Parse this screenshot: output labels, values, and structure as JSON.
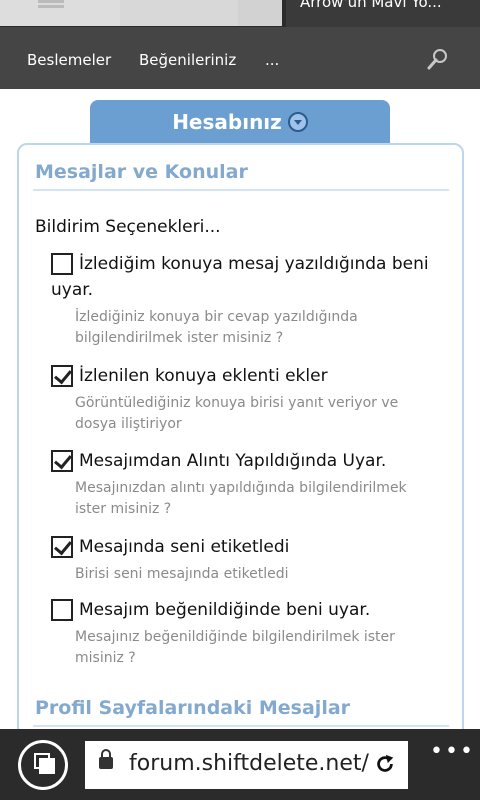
{
  "browser": {
    "active_tab_title": "Arrow'un Mavi Yo...",
    "url": "forum.shiftdelete.net/"
  },
  "nav": {
    "items": [
      "Beslemeler",
      "Beğenileriniz",
      "..."
    ]
  },
  "account_tab": {
    "label": "Hesabınız"
  },
  "sections": [
    {
      "title": "Mesajlar ve Konular"
    },
    {
      "title": "Profil Sayfalarındaki Mesajlar"
    }
  ],
  "notifications": {
    "heading": "Bildirim Seçenekleri...",
    "options": [
      {
        "label": "İzlediğim konuya mesaj yazıldığında beni uyar.",
        "hint": "İzlediğiniz konuya bir cevap yazıldığında bilgilendirilmek ister misiniz ?",
        "checked": false
      },
      {
        "label": "İzlenilen konuya eklenti ekler",
        "hint": "Görüntülediğiniz konuya birisi yanıt veriyor ve dosya iliştiriyor",
        "checked": true
      },
      {
        "label": "Mesajımdan Alıntı Yapıldığında Uyar.",
        "hint": "Mesajınızdan alıntı yapıldığında bilgilendirilmek ister misiniz ?",
        "checked": true
      },
      {
        "label": "Mesajında seni etiketledi",
        "hint": "Birisi seni mesajında etiketledi",
        "checked": true
      },
      {
        "label": "Mesajım beğenildiğinde beni uyar.",
        "hint": "Mesajınız beğenildiğinde bilgilendirilmek ister misiniz ?",
        "checked": false
      }
    ]
  },
  "icons": {
    "menu": "hamburger-menu-icon",
    "search": "search-icon",
    "dropdown": "chevron-down-circle-icon",
    "tabs": "tabs-icon",
    "lock": "lock-icon",
    "reload": "reload-icon",
    "more": "more-icon"
  },
  "colors": {
    "tab_blue": "#6c9fd1",
    "section_title": "#83a9cf",
    "panel_border": "#bcd6ee",
    "navbar": "#454545"
  }
}
